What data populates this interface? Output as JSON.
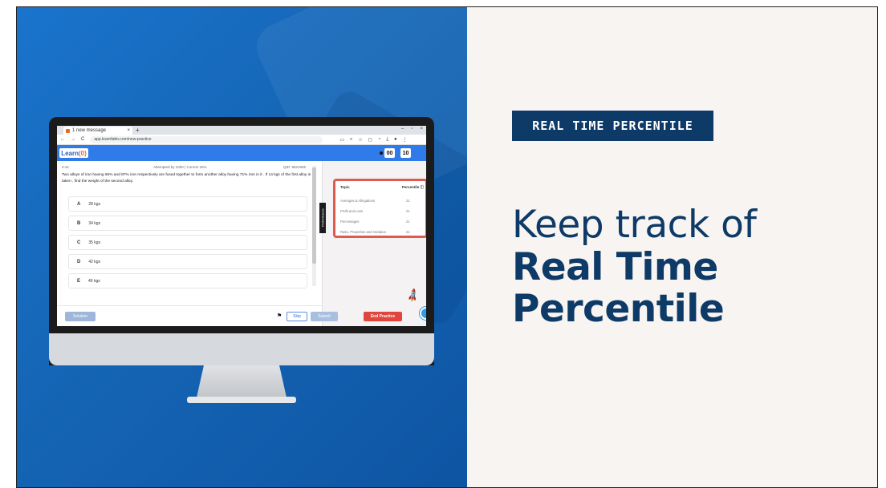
{
  "badge": "REAL TIME PERCENTILE",
  "headline": {
    "line1": "Keep track of",
    "line2": "Real Time",
    "line3": "Percentile"
  },
  "browser": {
    "tab_title": "1 new message",
    "tab_close": "×",
    "new_tab": "+",
    "window_controls": [
      "–",
      "▫",
      "×"
    ],
    "url": "app.learnfatto.com/new-practice",
    "nav_icons": [
      "←",
      "→",
      "C"
    ]
  },
  "app": {
    "logo_prefix": "Learn",
    "logo_accent": "(0)",
    "timer_minutes": "00",
    "timer_seconds": "10"
  },
  "question": {
    "time": "0:44",
    "attempted": "Attempted by 1000 | Correct 15%",
    "qid": "QID: 8621906",
    "text": "Two alloys of iron having 65% and 87% iron respectively are fused together to form another alloy having 71% iron in it . If 14 kgs of the first alloy is taken , find the weight of the second alloy.",
    "options": [
      {
        "letter": "A",
        "text": "28 kgs"
      },
      {
        "letter": "B",
        "text": "34 kgs"
      },
      {
        "letter": "C",
        "text": "35 kgs"
      },
      {
        "letter": "D",
        "text": "42 kgs"
      },
      {
        "letter": "E",
        "text": "49 kgs"
      }
    ]
  },
  "performance": {
    "tab_label": "Performance",
    "col_topic": "Topic",
    "col_percentile": "Percentile",
    "rows": [
      {
        "topic": "Averages & Allegations",
        "value": "21"
      },
      {
        "topic": "Profit and Loss",
        "value": "21"
      },
      {
        "topic": "Percentages",
        "value": "21"
      },
      {
        "topic": "Ratio, Proportion and Variation",
        "value": "21"
      }
    ]
  },
  "buttons": {
    "solution": "Solution",
    "skip": "Skip",
    "submit": "Submit",
    "end_practice": "End Practice"
  },
  "colors": {
    "brand_blue": "#2f7bea",
    "navy": "#0d3a66",
    "highlight_red": "#e15a50",
    "end_button": "#e0453e"
  }
}
